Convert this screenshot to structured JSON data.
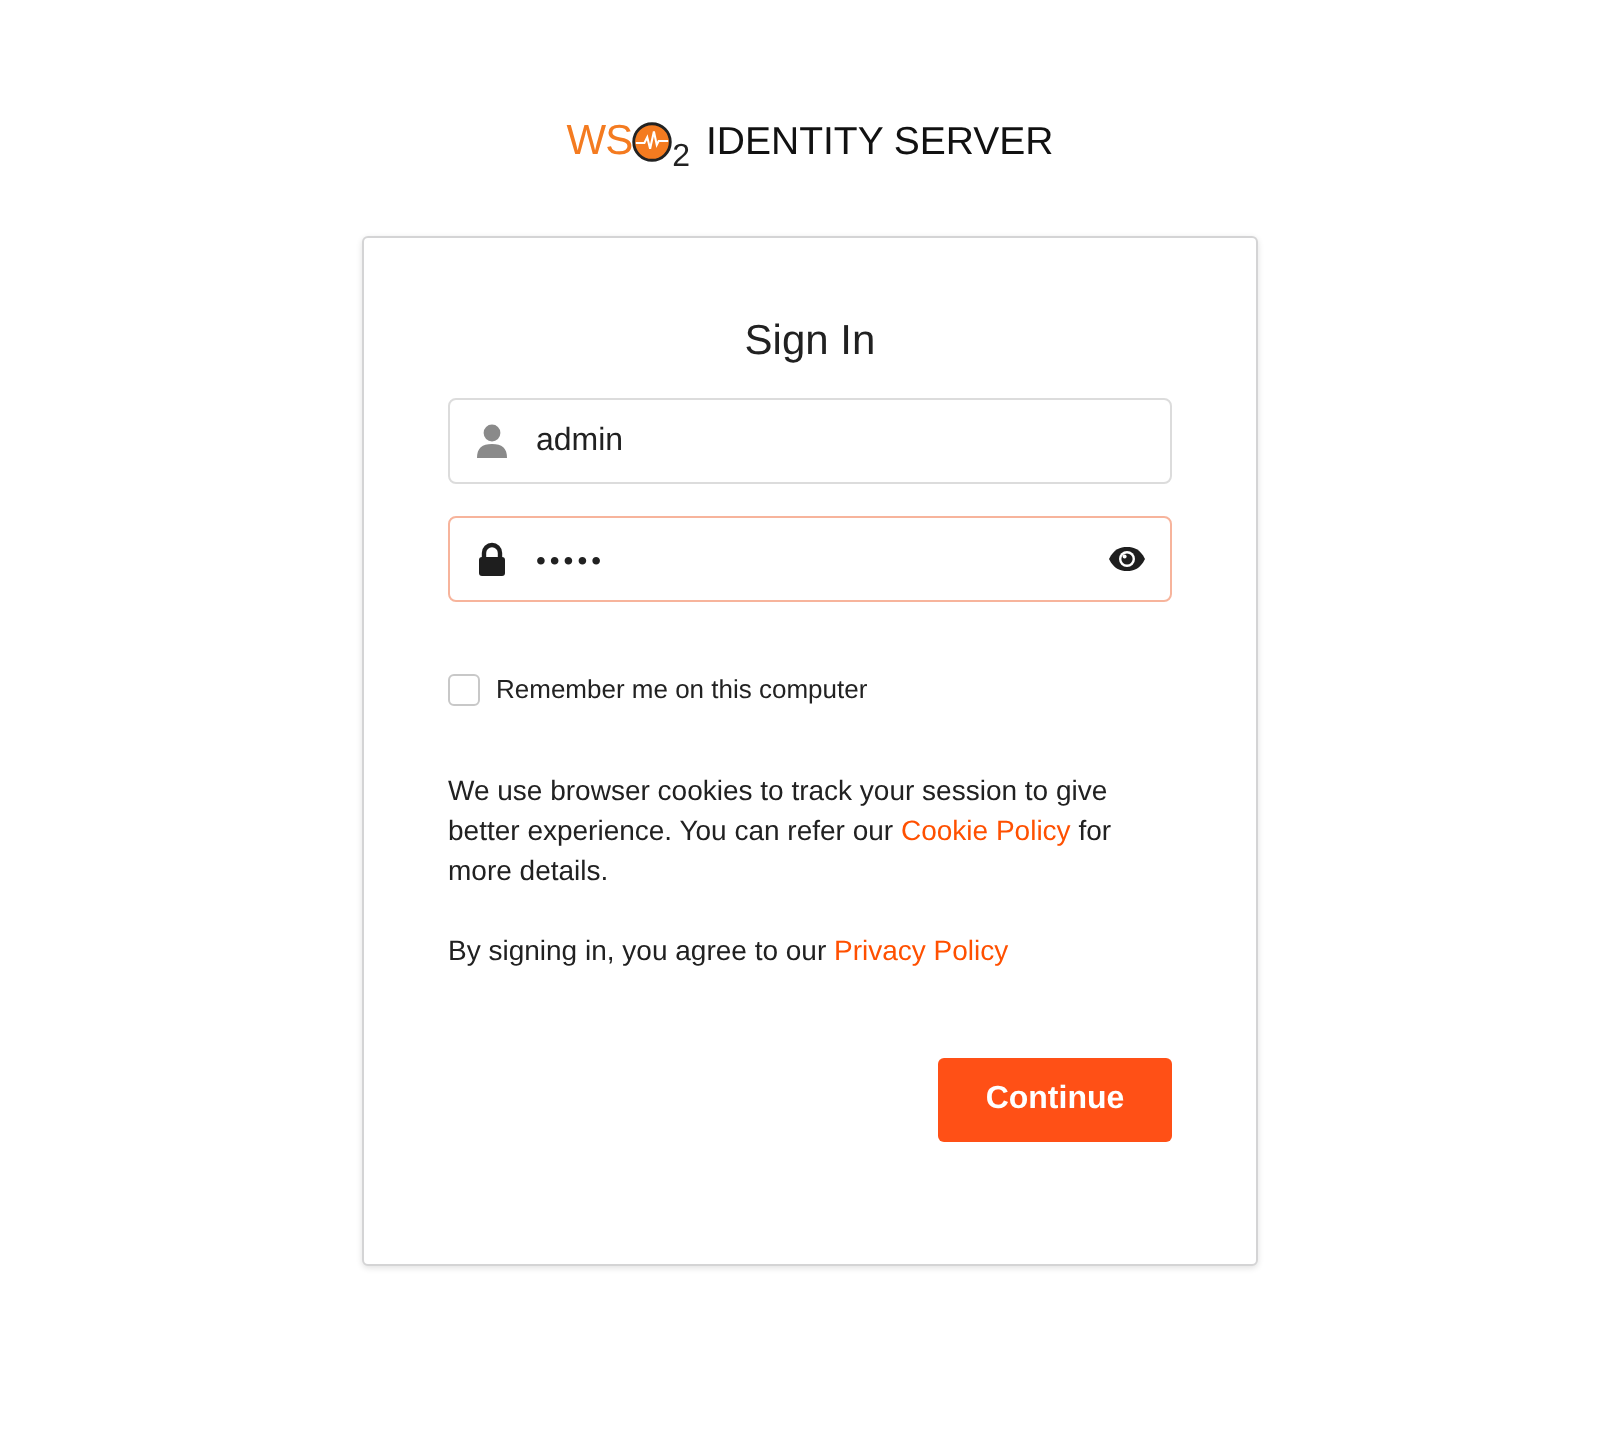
{
  "logo": {
    "prefix": "WS",
    "subscript": "2",
    "product": "IDENTITY SERVER"
  },
  "card": {
    "title": "Sign In",
    "username": {
      "value": "admin",
      "focused": false
    },
    "password": {
      "value": "•••••",
      "focused": true
    },
    "remember": {
      "label": "Remember me on this computer",
      "checked": false
    },
    "cookie_notice": {
      "before": "We use browser cookies to track your session to give better experience. You can refer our ",
      "link": "Cookie Policy",
      "after": " for more details."
    },
    "terms": {
      "before": "By signing in, you agree to our ",
      "link": "Privacy Policy"
    },
    "button": "Continue"
  }
}
